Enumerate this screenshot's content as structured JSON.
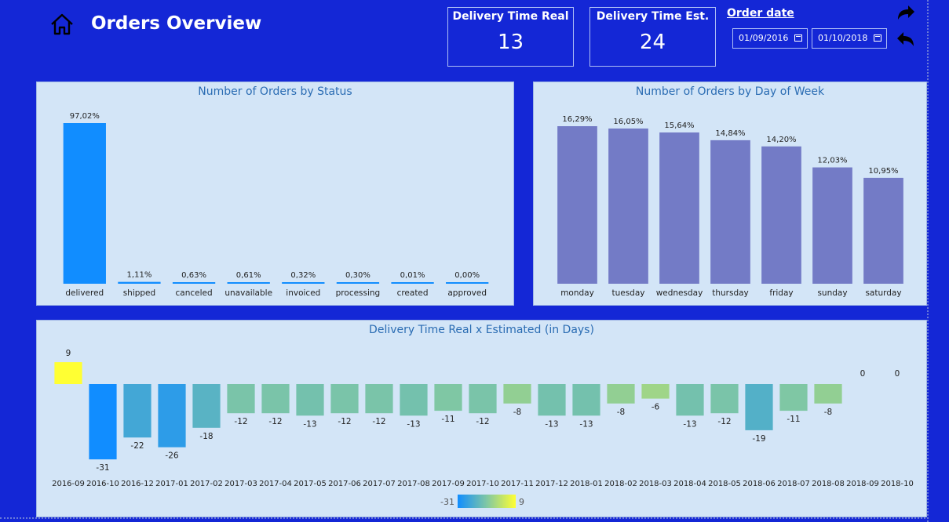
{
  "header": {
    "title": "Orders Overview",
    "home_icon": "home-icon"
  },
  "kpis": [
    {
      "label": "Delivery Time Real",
      "value": "13"
    },
    {
      "label": "Delivery Time Est.",
      "value": "24"
    }
  ],
  "date_filter": {
    "label": "Order date",
    "start": "01/09/2016",
    "end": "01/10/2018"
  },
  "nav": {
    "forward_icon": "redo-arrow-icon",
    "back_icon": "undo-arrow-icon"
  },
  "colors": {
    "background": "#1427d6",
    "panel": "#d3e5f7",
    "title": "#2a6cb3",
    "status_bar": "#118dff",
    "weekday_bar": "#737bc6"
  },
  "chart_data": [
    {
      "type": "bar",
      "title": "Number of Orders by Status",
      "categories": [
        "delivered",
        "shipped",
        "canceled",
        "unavailable",
        "invoiced",
        "processing",
        "created",
        "approved"
      ],
      "values": [
        97.02,
        1.11,
        0.63,
        0.61,
        0.32,
        0.3,
        0.01,
        0.0
      ],
      "labels": [
        "97,02%",
        "1,11%",
        "0,63%",
        "0,61%",
        "0,32%",
        "0,30%",
        "0,01%",
        "0,00%"
      ]
    },
    {
      "type": "bar",
      "title": "Number of Orders by Day of Week",
      "categories": [
        "monday",
        "tuesday",
        "wednesday",
        "thursday",
        "friday",
        "sunday",
        "saturday"
      ],
      "values": [
        16.29,
        16.05,
        15.64,
        14.84,
        14.2,
        12.03,
        10.95
      ],
      "labels": [
        "16,29%",
        "16,05%",
        "15,64%",
        "14,84%",
        "14,20%",
        "12,03%",
        "10,95%"
      ]
    },
    {
      "type": "bar",
      "title": "Delivery Time Real x Estimated (in Days)",
      "categories": [
        "2016-09",
        "2016-10",
        "2016-12",
        "2017-01",
        "2017-02",
        "2017-03",
        "2017-04",
        "2017-05",
        "2017-06",
        "2017-07",
        "2017-08",
        "2017-09",
        "2017-10",
        "2017-11",
        "2017-12",
        "2018-01",
        "2018-02",
        "2018-03",
        "2018-04",
        "2018-05",
        "2018-06",
        "2018-07",
        "2018-08",
        "2018-09",
        "2018-10"
      ],
      "values": [
        9,
        -31,
        -22,
        -26,
        -18,
        -12,
        -12,
        -13,
        -12,
        -12,
        -13,
        -11,
        -12,
        -8,
        -13,
        -13,
        -8,
        -6,
        -13,
        -12,
        -19,
        -11,
        -8,
        0,
        0
      ],
      "legend": {
        "min": "-31",
        "max": "9",
        "min_color": "#118dff",
        "mid_color": "#7fc7a4",
        "max_color": "#ffff33"
      }
    }
  ]
}
